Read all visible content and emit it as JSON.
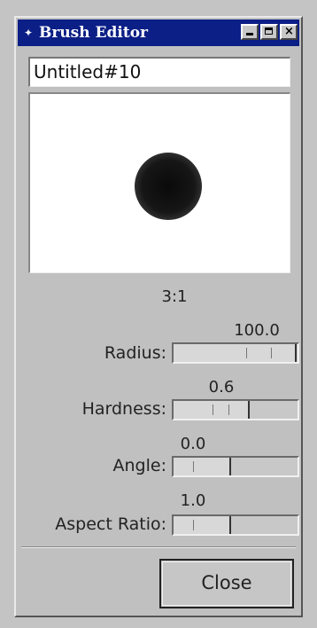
{
  "window": {
    "title": "Brush Editor",
    "title_icon": "app-menu-icon"
  },
  "titlebar_buttons": [
    {
      "name": "minimize-button",
      "icon": "minimize-icon"
    },
    {
      "name": "maximize-button",
      "icon": "maximize-icon"
    },
    {
      "name": "close-window-button",
      "icon": "close-icon"
    }
  ],
  "brush": {
    "name": "Untitled#10",
    "preview_label": "3:1"
  },
  "params": {
    "radius": {
      "label": "Radius:",
      "value": "100.0",
      "fraction": 0.98
    },
    "hardness": {
      "label": "Hardness:",
      "value": "0.6",
      "fraction": 0.6
    },
    "angle": {
      "label": "Angle:",
      "value": "0.0",
      "fraction": 0.45
    },
    "aspect_ratio": {
      "label": "Aspect Ratio:",
      "value": "1.0",
      "fraction": 0.45
    }
  },
  "actions": {
    "close_label": "Close"
  }
}
